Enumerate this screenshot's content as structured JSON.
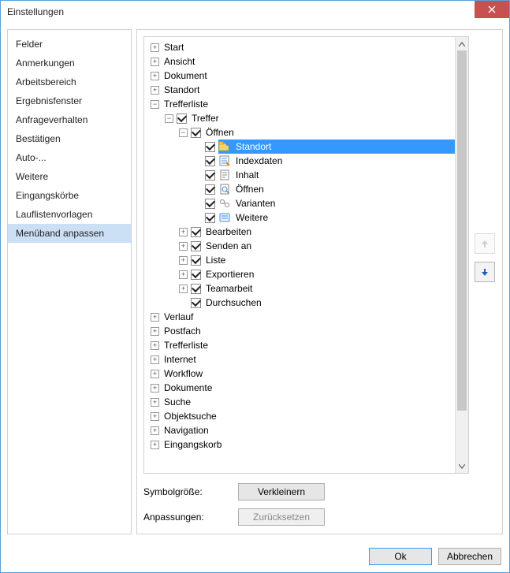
{
  "window": {
    "title": "Einstellungen"
  },
  "sidebar": {
    "items": [
      {
        "label": "Felder"
      },
      {
        "label": "Anmerkungen"
      },
      {
        "label": "Arbeitsbereich"
      },
      {
        "label": "Ergebnisfenster"
      },
      {
        "label": "Anfrageverhalten"
      },
      {
        "label": "Bestätigen"
      },
      {
        "label": "Auto-..."
      },
      {
        "label": "Weitere"
      },
      {
        "label": "Eingangskörbe"
      },
      {
        "label": "Lauflistenvorlagen"
      },
      {
        "label": "Menüband anpassen",
        "selected": true
      }
    ]
  },
  "tree": {
    "rows": [
      {
        "indent": 0,
        "expander": "plus",
        "label": "Start"
      },
      {
        "indent": 0,
        "expander": "plus",
        "label": "Ansicht"
      },
      {
        "indent": 0,
        "expander": "plus",
        "label": "Dokument"
      },
      {
        "indent": 0,
        "expander": "plus",
        "label": "Standort"
      },
      {
        "indent": 0,
        "expander": "minus",
        "label": "Trefferliste"
      },
      {
        "indent": 1,
        "expander": "minus",
        "check": true,
        "label": "Treffer"
      },
      {
        "indent": 2,
        "expander": "minus",
        "check": true,
        "label": "Öffnen"
      },
      {
        "indent": 3,
        "expander": "none",
        "check": true,
        "icon": "location",
        "label": "Standort",
        "selected": true
      },
      {
        "indent": 3,
        "expander": "none",
        "check": true,
        "icon": "indexdata",
        "label": "Indexdaten"
      },
      {
        "indent": 3,
        "expander": "none",
        "check": true,
        "icon": "content",
        "label": "Inhalt"
      },
      {
        "indent": 3,
        "expander": "none",
        "check": true,
        "icon": "open",
        "label": "Öffnen"
      },
      {
        "indent": 3,
        "expander": "none",
        "check": true,
        "icon": "variants",
        "label": "Varianten"
      },
      {
        "indent": 3,
        "expander": "none",
        "check": true,
        "icon": "more",
        "label": "Weitere"
      },
      {
        "indent": 2,
        "expander": "plus",
        "check": true,
        "label": "Bearbeiten"
      },
      {
        "indent": 2,
        "expander": "plus",
        "check": true,
        "label": "Senden an"
      },
      {
        "indent": 2,
        "expander": "plus",
        "check": true,
        "label": "Liste"
      },
      {
        "indent": 2,
        "expander": "plus",
        "check": true,
        "label": "Exportieren"
      },
      {
        "indent": 2,
        "expander": "plus",
        "check": true,
        "label": "Teamarbeit"
      },
      {
        "indent": 2,
        "expander": "none",
        "check": true,
        "label": "Durchsuchen"
      },
      {
        "indent": 0,
        "expander": "plus",
        "label": "Verlauf"
      },
      {
        "indent": 0,
        "expander": "plus",
        "label": "Postfach"
      },
      {
        "indent": 0,
        "expander": "plus",
        "label": "Trefferliste"
      },
      {
        "indent": 0,
        "expander": "plus",
        "label": "Internet"
      },
      {
        "indent": 0,
        "expander": "plus",
        "label": "Workflow"
      },
      {
        "indent": 0,
        "expander": "plus",
        "label": "Dokumente"
      },
      {
        "indent": 0,
        "expander": "plus",
        "label": "Suche"
      },
      {
        "indent": 0,
        "expander": "plus",
        "label": "Objektsuche"
      },
      {
        "indent": 0,
        "expander": "plus",
        "label": "Navigation"
      },
      {
        "indent": 0,
        "expander": "plus",
        "label": "Eingangskorb"
      }
    ]
  },
  "form": {
    "symbol_size_label": "Symbolgröße:",
    "symbol_size_button": "Verkleinern",
    "reset_label": "Anpassungen:",
    "reset_button": "Zurücksetzen"
  },
  "footer": {
    "ok": "Ok",
    "cancel": "Abbrechen"
  }
}
